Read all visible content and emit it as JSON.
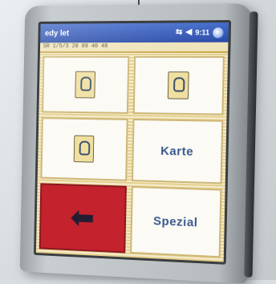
{
  "window": {
    "title": "edy let",
    "status_text": "9:11"
  },
  "info_strip": {
    "text": "SR 1/5/3 28 09 40 48"
  },
  "tiles": [
    {
      "type": "icon",
      "icon": "card-reader-icon",
      "label": ""
    },
    {
      "type": "icon",
      "icon": "card-reader-icon",
      "label": ""
    },
    {
      "type": "icon",
      "icon": "card-reader-icon",
      "label": ""
    },
    {
      "type": "text",
      "label": "Karte"
    },
    {
      "type": "back",
      "icon": "arrow-left-icon",
      "label": ""
    },
    {
      "type": "text",
      "label": "Spezial"
    }
  ],
  "colors": {
    "title_bar": "#2547a6",
    "back_tile": "#c4222d",
    "label_text": "#3a5a8f"
  }
}
